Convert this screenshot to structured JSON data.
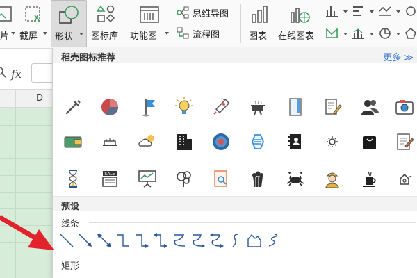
{
  "ribbon": {
    "partial_left_label": "片",
    "screenshot_label": "截屏",
    "shapes_label": "形状",
    "iconlib_label": "图标库",
    "funcchart_label": "功能图",
    "mindmap_label": "思维导图",
    "flowchart_label": "流程图",
    "chart_label": "图表",
    "online_chart_label": "在线图表"
  },
  "formula_bar": {
    "fx_label": "fx"
  },
  "sheet": {
    "column_letter": "D",
    "fill_color": "#d7ecd9"
  },
  "panel": {
    "title": "稻壳图标推荐",
    "more_label": "更多",
    "preset_label": "预设",
    "lines_label": "线条",
    "rect_label": "矩形",
    "icons_row1": [
      "syringe-icon",
      "pie-chart-icon",
      "flag-icon",
      "lightbulb-icon",
      "rocket-icon",
      "cooking-pot-icon",
      "bookmark-icon",
      "notepad-pen-icon",
      "users-icon",
      "camera-icon"
    ],
    "icons_row2": [
      "wallet-icon",
      "cake-icon",
      "cloud-sun-icon",
      "building-icon",
      "target-icon",
      "hexagon-icon",
      "contacts-book-icon",
      "sun-icon",
      "shopping-bag-icon",
      "edit-document-icon"
    ],
    "icons_row3": [
      "hourglass-icon",
      "sale-sign-icon",
      "presentation-icon",
      "tree-icon",
      "search-document-icon",
      "popcorn-icon",
      "crab-icon",
      "worker-icon",
      "cup-icon",
      "bell-icon"
    ],
    "accent_color": "#2f6fd1",
    "shape_color": "#2b5797"
  },
  "annotation": {
    "arrow_color": "#e3232c"
  }
}
